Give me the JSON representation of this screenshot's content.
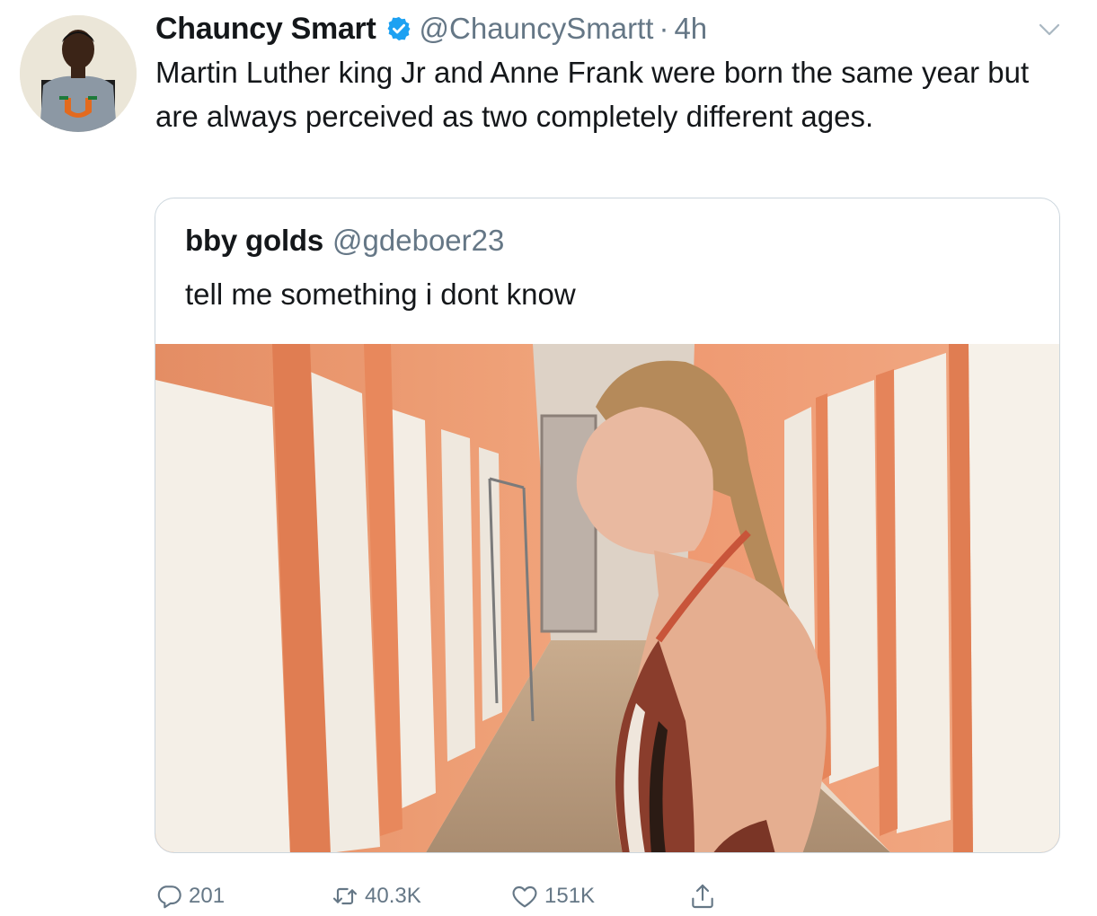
{
  "author": {
    "display_name": "Chauncy Smart",
    "handle": "@ChauncySmartt",
    "separator": "·",
    "time": "4h",
    "verified": true,
    "avatar": "profile-photo"
  },
  "tweet": {
    "text": "Martin Luther king Jr and Anne Frank were born the same year but are always perceived as two completely different ages."
  },
  "quoted_tweet": {
    "display_name": "bby golds",
    "handle": "@gdeboer23",
    "text": "tell me something i dont know",
    "media": "photo-fitting-room"
  },
  "actions": {
    "replies": "201",
    "retweets": "40.3K",
    "likes": "151K"
  },
  "colors": {
    "text": "#14171a",
    "secondary": "#657786",
    "verified_blue": "#1da1f2",
    "border": "#ccd6dd"
  },
  "icons": {
    "verified": "verified-badge-icon",
    "caret": "chevron-down-icon",
    "reply": "reply-icon",
    "retweet": "retweet-icon",
    "like": "heart-icon",
    "share": "share-icon"
  }
}
